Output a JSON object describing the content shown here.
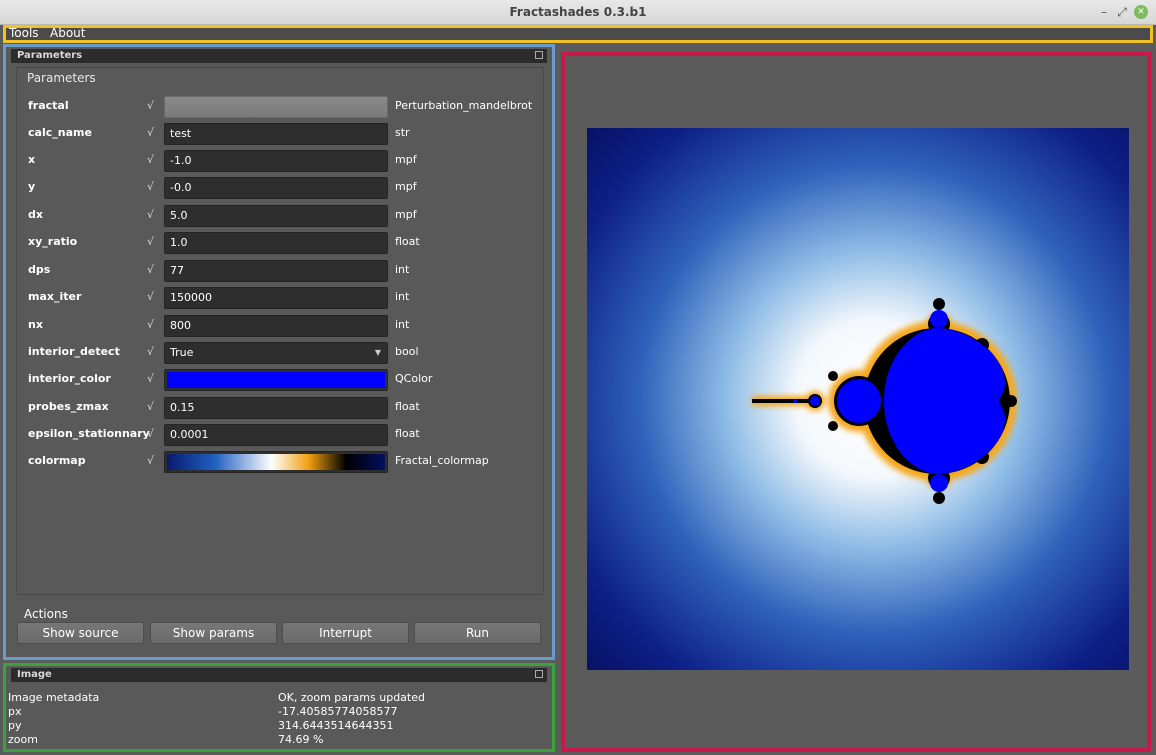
{
  "window": {
    "title": "Fractashades 0.3.b1",
    "minimize_glyph": "–",
    "restore_glyph": "⤢",
    "close_glyph": "✕"
  },
  "menu": {
    "items": [
      "Tools",
      "About"
    ]
  },
  "params_dock": {
    "title": "Parameters",
    "group_label": "Parameters",
    "check_glyph": "√",
    "rows": [
      {
        "name": "fractal",
        "value": "",
        "type": "Perturbation_mandelbrot",
        "editor": "button"
      },
      {
        "name": "calc_name",
        "value": "test",
        "type": "str",
        "editor": "text"
      },
      {
        "name": "x",
        "value": "-1.0",
        "type": "mpf",
        "editor": "text"
      },
      {
        "name": "y",
        "value": "-0.0",
        "type": "mpf",
        "editor": "text"
      },
      {
        "name": "dx",
        "value": "5.0",
        "type": "mpf",
        "editor": "text"
      },
      {
        "name": "xy_ratio",
        "value": "1.0",
        "type": "float",
        "editor": "text"
      },
      {
        "name": "dps",
        "value": "77",
        "type": "int",
        "editor": "text"
      },
      {
        "name": "max_iter",
        "value": "150000",
        "type": "int",
        "editor": "text"
      },
      {
        "name": "nx",
        "value": "800",
        "type": "int",
        "editor": "text"
      },
      {
        "name": "interior_detect",
        "value": "True",
        "type": "bool",
        "editor": "combo"
      },
      {
        "name": "interior_color",
        "value": "",
        "type": "QColor",
        "editor": "color"
      },
      {
        "name": "probes_zmax",
        "value": "0.15",
        "type": "float",
        "editor": "text"
      },
      {
        "name": "epsilon_stationnary",
        "value": "0.0001",
        "type": "float",
        "editor": "text"
      },
      {
        "name": "colormap",
        "value": "",
        "type": "Fractal_colormap",
        "editor": "colormap"
      }
    ],
    "actions_label": "Actions",
    "actions": [
      "Show source",
      "Show params",
      "Interrupt",
      "Run"
    ]
  },
  "image_dock": {
    "title": "Image",
    "rows": [
      {
        "label": "Image metadata",
        "value": "OK, zoom params updated"
      },
      {
        "label": "px",
        "value": "-17.40585774058577"
      },
      {
        "label": "py",
        "value": "314.6443514644351"
      },
      {
        "label": "zoom",
        "value": "74.69 %"
      }
    ]
  },
  "colors": {
    "interior_color": "#0000ff",
    "highlight_menubar": "#f2c225",
    "highlight_params": "#6b9bcb",
    "highlight_image": "#3aa33a",
    "highlight_view": "#c9184a",
    "colormap_stops": [
      "#0a1a6e",
      "#2060c0",
      "#ffffff",
      "#f0a010",
      "#000000",
      "#05105e"
    ]
  },
  "icons": {
    "dock_float": "float-icon",
    "combo_arrow": "chevron-down-icon"
  }
}
